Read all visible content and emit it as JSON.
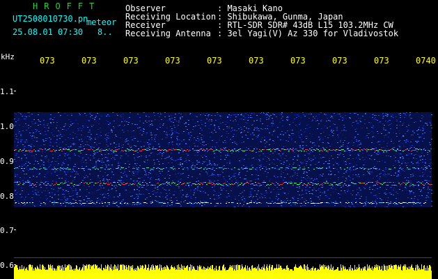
{
  "header": {
    "logo": "HROFFT",
    "filename": "UT2508010730.pn",
    "file_type": "meteor",
    "datetime": "25.08.01 07:30",
    "count": "8..",
    "fields": [
      {
        "label": "Observer",
        "value": ": Masaki Kano"
      },
      {
        "label": "Receiving Location",
        "value": ": Shibukawa, Gunma, Japan"
      },
      {
        "label": "Receiver",
        "value": ": RTL-SDR SDR# 43dB L15 103.2MHz CW"
      },
      {
        "label": "Receiving Antenna",
        "value": ": 3el Yagi(V) Az 330 for Vladivostok"
      }
    ]
  },
  "y_axis": {
    "unit": "kHz",
    "ticks": [
      "1.1",
      "1.0",
      "0.9",
      "0.8",
      "0.7",
      "0.6"
    ]
  },
  "x_axis": {
    "ticks": [
      "073",
      "073",
      "073",
      "073",
      "073",
      "073",
      "073",
      "073",
      "073",
      "0740"
    ]
  },
  "colors": {
    "logo": "#2ecc40",
    "labels": "#ffffff",
    "filename": "#00ffff",
    "time_ticks": "#ffff00",
    "signal_level": "#ffff00",
    "background": "#000000"
  }
}
